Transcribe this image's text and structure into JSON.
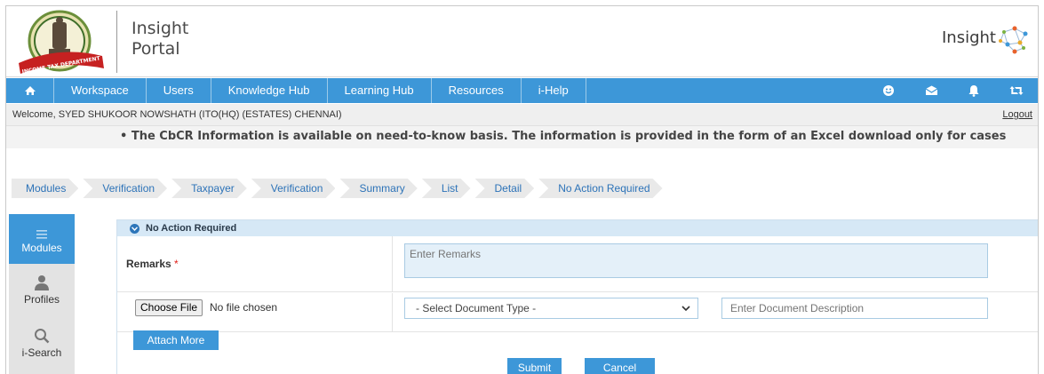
{
  "header": {
    "title_line1": "Insight",
    "title_line2": "Portal",
    "brand_word": "Insight",
    "emblem_caption": "INCOME TAX DEPARTMENT"
  },
  "nav": {
    "home_icon": "home-icon",
    "items": [
      "Workspace",
      "Users",
      "Knowledge Hub",
      "Learning Hub",
      "Resources",
      "i-Help"
    ],
    "right_icons": [
      "smiley-icon",
      "envelope-icon",
      "bell-icon",
      "retweet-icon"
    ]
  },
  "welcome": {
    "text": "Welcome, SYED SHUKOOR NOWSHATH (ITO(HQ) (ESTATES) CHENNAI)",
    "logout": "Logout"
  },
  "ticker": {
    "text": "• The CbCR Information is available on need-to-know basis. The information is provided in the form of an Excel download only for cases"
  },
  "breadcrumb": [
    "Modules",
    "Verification",
    "Taxpayer",
    "Verification",
    "Summary",
    "List",
    "Detail",
    "No Action Required"
  ],
  "sidebar": {
    "items": [
      {
        "label": "Modules",
        "icon": "menu-icon"
      },
      {
        "label": "Profiles",
        "icon": "user-icon"
      },
      {
        "label": "i-Search",
        "icon": "search-icon"
      }
    ]
  },
  "panel": {
    "title": "No Action Required",
    "remarks_label": "Remarks",
    "required_mark": "*",
    "remarks_placeholder": "Enter Remarks",
    "choose_file": "Choose File",
    "file_status": "No file chosen",
    "doc_type_selected": "- Select Document Type -",
    "doc_desc_placeholder": "Enter Document Description",
    "attach_more": "Attach More",
    "submit": "Submit",
    "cancel": "Cancel"
  },
  "colors": {
    "accent": "#3d97d8",
    "panel_header": "#d6e8f6",
    "required": "#e0201a"
  }
}
